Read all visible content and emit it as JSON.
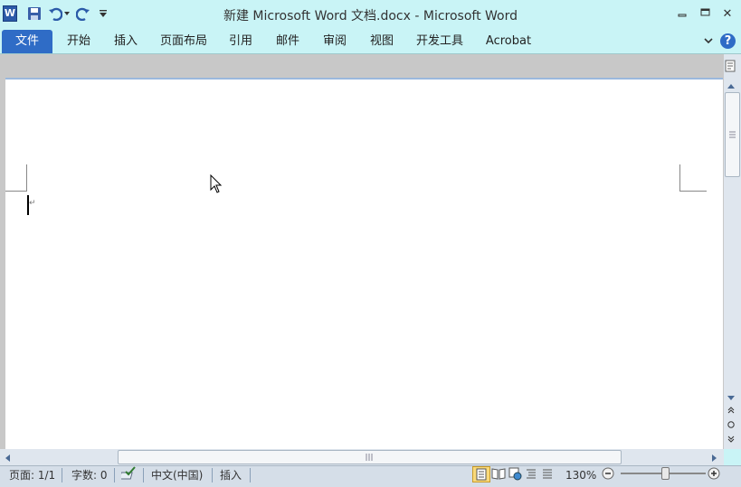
{
  "window": {
    "title": "新建 Microsoft Word 文档.docx - Microsoft Word",
    "minimize_symbol": "▫",
    "restore_symbol": "▭",
    "close_symbol": "✕"
  },
  "quick_access": {
    "app_icon_letter": "W",
    "icons": [
      "save-icon",
      "undo-icon",
      "redo-icon",
      "customize-qat-icon"
    ]
  },
  "ribbon": {
    "tabs": [
      "文件",
      "开始",
      "插入",
      "页面布局",
      "引用",
      "邮件",
      "审阅",
      "视图",
      "开发工具",
      "Acrobat"
    ],
    "help_symbol": "?"
  },
  "document": {
    "paragraph_mark": "↵"
  },
  "status_bar": {
    "page": "页面: 1/1",
    "words": "字数: 0",
    "language": "中文(中国)",
    "mode": "插入",
    "zoom": "130%",
    "zoom_level_fraction": 0.5
  },
  "colors": {
    "ribbon_background": "#c9f4f6",
    "file_tab": "#2f6cc6",
    "status_bar": "#d5dee8"
  }
}
